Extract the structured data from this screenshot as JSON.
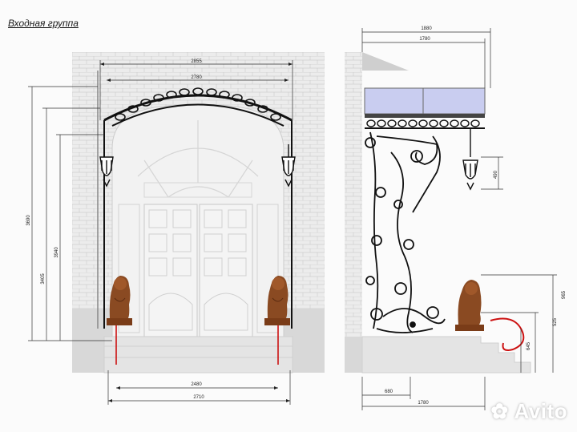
{
  "title": "Входная группа",
  "watermark": "Avito",
  "front": {
    "top_width_outer": "2855",
    "top_width_inner": "2780",
    "height_total": "3690",
    "height_mid": "3940",
    "height_inner": "3405",
    "bottom_width_inner": "2480",
    "bottom_width_outer": "2710"
  },
  "side": {
    "top_outer": "1880",
    "top_inner": "1780",
    "lamp_drop": "490",
    "h_965": "965",
    "h_525": "525",
    "h_645": "645",
    "bottom_680": "680",
    "bottom_1780": "1780"
  },
  "colors": {
    "brick": "#e6e6e6",
    "brick_line": "#c9c9c9",
    "iron": "#111111",
    "glass": "#c9cdf0",
    "lion": "#8a4a22",
    "dim_red": "#cc1111"
  }
}
